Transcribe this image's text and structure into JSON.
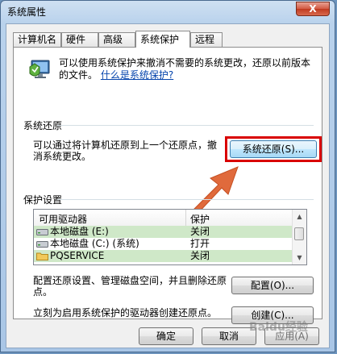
{
  "window": {
    "title": "系统属性",
    "close_label": "X"
  },
  "tabs": [
    {
      "label": "计算机名",
      "active": false
    },
    {
      "label": "硬件",
      "active": false
    },
    {
      "label": "高级",
      "active": false
    },
    {
      "label": "系统保护",
      "active": true
    },
    {
      "label": "远程",
      "active": false
    }
  ],
  "intro": {
    "text": "可以使用系统保护来撤消不需要的系统更改，还原以前版本的文件。",
    "link": "什么是系统保护?"
  },
  "restore": {
    "group_title": "系统还原",
    "description": "可以通过将计算机还原到上一个还原点，撤消系统更改。",
    "button_label": "系统还原(S)..."
  },
  "protection": {
    "group_title": "保护设置",
    "columns": [
      "可用驱动器",
      "保护"
    ],
    "drives": [
      {
        "name": "本地磁盘 (E:)",
        "protection": "关闭",
        "selected": true
      },
      {
        "name": "本地磁盘 (C:) (系统)",
        "protection": "打开",
        "selected": false
      },
      {
        "name": "PQSERVICE",
        "protection": "关闭",
        "selected": true
      }
    ],
    "configure_text": "配置还原设置、管理磁盘空间，并且删除还原点。",
    "configure_button": "配置(O)...",
    "create_text": "立刻为启用系统保护的驱动器创建还原点。",
    "create_button": "创建(C)..."
  },
  "footer": {
    "ok": "确定",
    "cancel": "取消",
    "apply": "应用(A)"
  },
  "watermark": "Baidu经验",
  "colors": {
    "highlight": "#d90000",
    "arrow": "#e06a3c",
    "selected_row": "#cfe8c8",
    "link": "#0645ad"
  }
}
